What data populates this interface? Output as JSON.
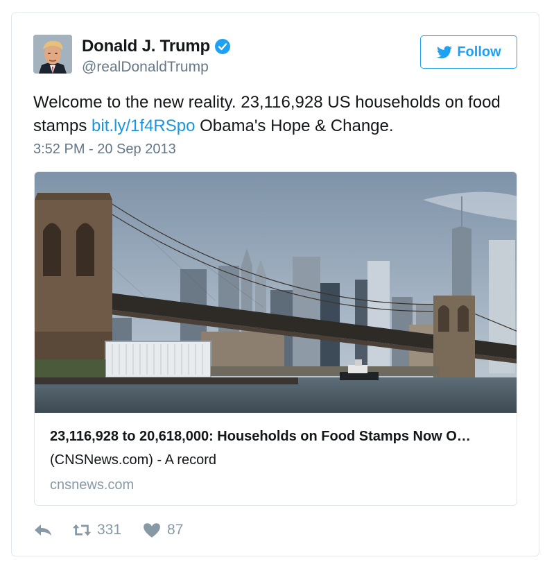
{
  "user": {
    "display_name": "Donald J. Trump",
    "handle": "@realDonaldTrump",
    "verified": true,
    "avatar_icon": "profile-photo"
  },
  "follow_button": {
    "label": "Follow",
    "icon": "twitter-bird-icon"
  },
  "tweet": {
    "text_before": "Welcome to the new reality. 23,116,928 US households on food stamps ",
    "link": "bit.ly/1f4RSpo",
    "text_after": " Obama's Hope & Change.",
    "timestamp": "3:52 PM - 20 Sep 2013"
  },
  "card": {
    "image_description": "Brooklyn Bridge with Manhattan skyline",
    "title": "23,116,928 to 20,618,000: Households on Food Stamps Now O…",
    "description": "(CNSNews.com) - A record",
    "domain": "cnsnews.com"
  },
  "actions": {
    "reply_icon": "reply-icon",
    "retweet_icon": "retweet-icon",
    "retweet_count": "331",
    "like_icon": "heart-icon",
    "like_count": "87"
  },
  "colors": {
    "accent": "#1da1f2",
    "link": "#1b95e0",
    "secondary_text": "#657786",
    "muted": "#8899a6",
    "border": "#e1e8ed"
  }
}
